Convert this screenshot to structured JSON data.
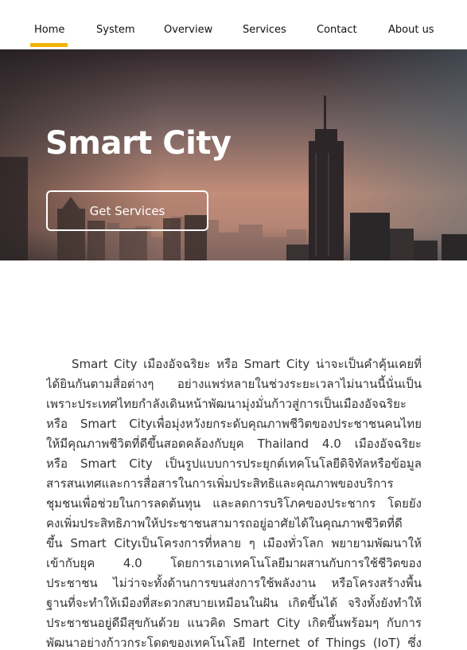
{
  "nav": {
    "items": [
      {
        "label": "Home"
      },
      {
        "label": "System"
      },
      {
        "label": "Overview"
      },
      {
        "label": "Services"
      },
      {
        "label": "Contact"
      },
      {
        "label": "About us"
      }
    ],
    "active_color": "#f0b400"
  },
  "hero": {
    "title": "Smart City",
    "button_label": "Get Services"
  },
  "article": {
    "lines": [
      "Smart City เมืองอัจฉริยะ หรือ Smart City น่าจะเป็นคำคุ้นเคยที่",
      "ได้ยินกันตามสื่อต่างๆ    อย่างแพร่หลายในช่วงระยะเวลาไม่นานนี้นั่นเป็น",
      "เพราะประเทศไทยกำลังเดินหน้าพัฒนามุ่งมั่นก้าวสู่การเป็นเมืองอัจฉริยะ",
      "หรือ Smart Cityเพื่อมุ่งหวังยกระดับคุณภาพชีวิตของประชาชนคนไทย",
      "ให้มีคุณภาพชีวิตที่ดีขึ้นสอดคล้องกับยุค Thailand 4.0 เมืองอัจฉริยะ",
      "หรือ  Smart  City  เป็นรูปแบบการประยุกต์เทคโนโลยีดิจิทัลหรือข้อมูล",
      "สารสนเทศและการสื่อสารในการเพิ่มประสิทธิและคุณภาพของบริการ",
      "ชุมชนเพื่อช่วยในการลดต้นทุน  และลดการบริโภคของประชากร  โดยยัง",
      "คงเพิ่มประสิทธิภาพให้ประชาชนสามารถอยู่อาศัยได้ในคุณภาพชีวิตที่ดี",
      "ขึ้น Smart Cityเป็นโครงการที่หลาย ๆ เมืองทั่วโลก พยายามพัฒนาให้",
      "เข้ากับยุค       4.0       โดยการเอาเทคโนโลยีมาผสานกับการใช้ชีวิตของ",
      "ประชาชน   ไม่ว่าจะทั้งด้านการขนส่งการใช้พลังงาน   หรือโครงสร้างพื้น",
      "ฐานที่จะทำให้เมืองที่สะดวกสบายเหมือนในฝัน เกิดขึ้นได้ จริงทั้งยังทำให้",
      "ประชาชนอยู่ดีมีสุขกันด้วย แนวคิด Smart City เกิดขึ้นพร้อมๆ กับการ",
      "พัฒนาอย่างก้าวกระโดดของเทคโนโลยี Internet of Things (IoT) ซึ่ง"
    ]
  }
}
